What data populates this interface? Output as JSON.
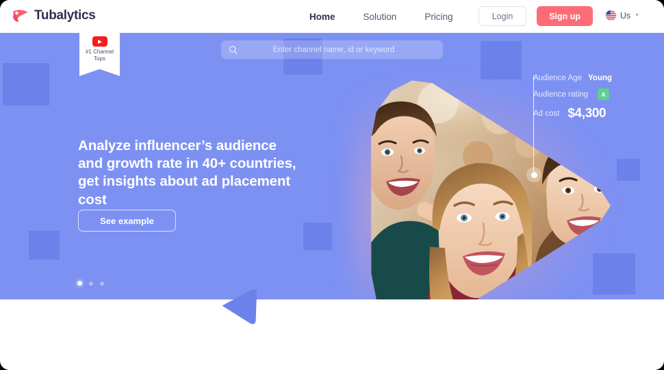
{
  "brand": {
    "name": "Tubalytics",
    "logo_icon": "play-swoosh-icon",
    "accent": "#fb6c77",
    "hero_bg": "#7d91f3"
  },
  "header": {
    "nav": [
      {
        "label": "Home",
        "active": true
      },
      {
        "label": "Solution",
        "active": false
      },
      {
        "label": "Pricing",
        "active": false
      }
    ],
    "login_label": "Login",
    "signup_label": "Sign up",
    "locale": {
      "label": "Us",
      "flag_icon": "us-flag-icon",
      "caret_icon": "chevron-down-icon"
    }
  },
  "badge": {
    "icon": "youtube-play-icon",
    "line1": "#1 Channel",
    "line2": "Tops"
  },
  "search": {
    "icon": "search-icon",
    "placeholder": "Enter channel name, id or keyword",
    "value": ""
  },
  "hero": {
    "headline": "Analyze influencer’s audience and growth rate in 40+ countries, get insights about ad placement cost",
    "cta_label": "See example",
    "carousel": {
      "count": 3,
      "active_index": 0
    }
  },
  "stats": {
    "age_label": "Audience Age",
    "age_value": "Young",
    "rating_label": "Audience rating",
    "rating_value": "A",
    "rating_color": "#5ed18e",
    "cost_label": "Ad cost",
    "cost_value": "$4,300"
  }
}
